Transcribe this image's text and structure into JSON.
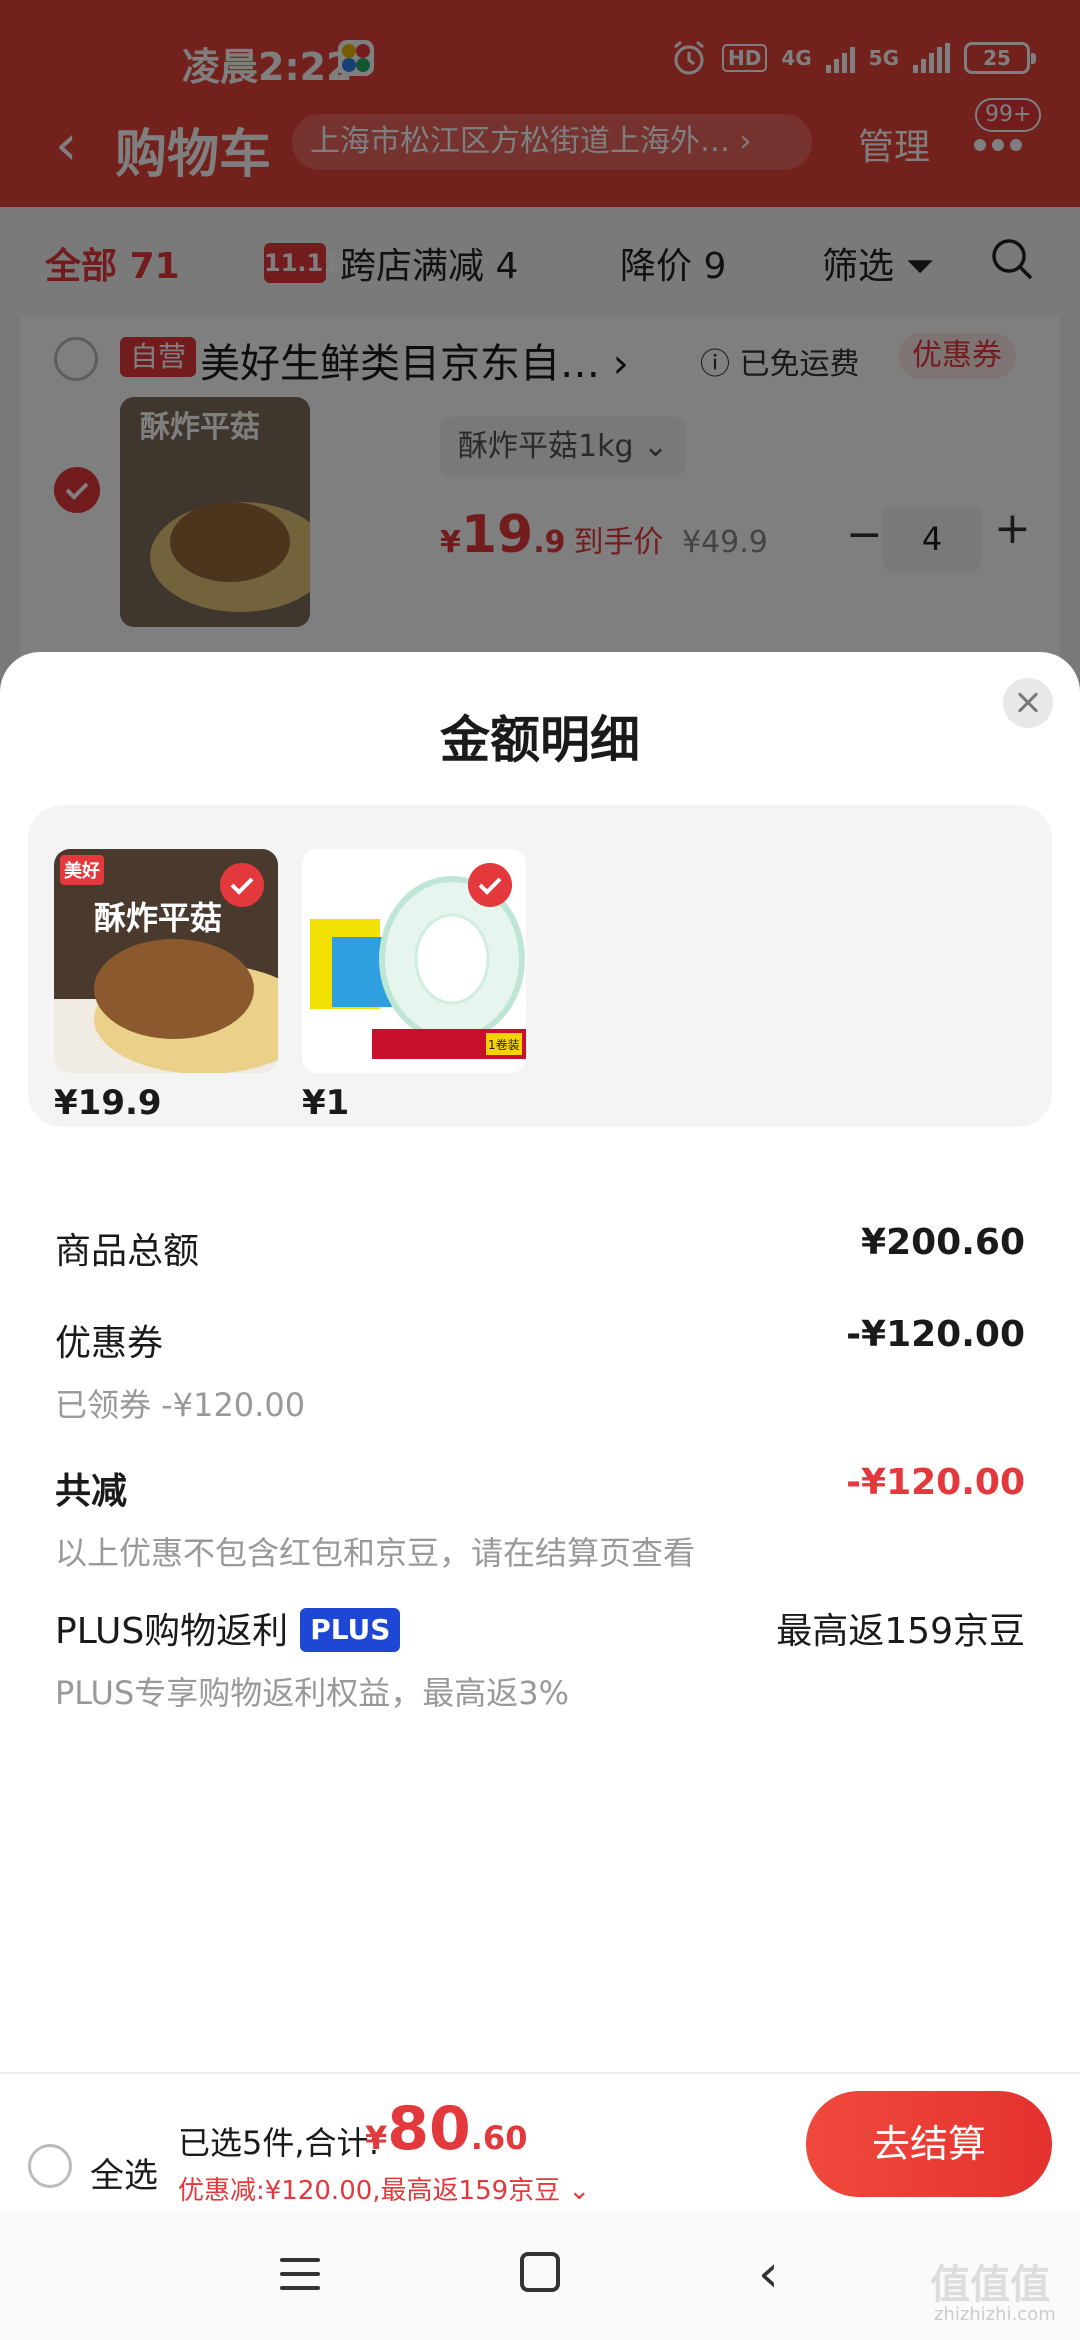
{
  "status_bar": {
    "time": "凌晨2:22",
    "hd": "HD",
    "net1": "4G",
    "net2": "5G",
    "battery": "25"
  },
  "nav": {
    "title": "购物车",
    "address": "上海市松江区方松街道上海外…",
    "manage": "管理",
    "badge": "99+"
  },
  "filters": {
    "all_label": "全部",
    "all_count": "71",
    "cross_icon_text": "11.11",
    "cross_label": "跨店满减",
    "cross_count": "4",
    "drop_label": "降价",
    "drop_count": "9",
    "filter_label": "筛选"
  },
  "shop": {
    "tag": "自营",
    "name": "美好生鲜类目京东自…",
    "arrow": "›",
    "shipping": "已免运费",
    "coupon": "优惠券"
  },
  "cart_item": {
    "spec": "酥炸平菇1kg ⌄",
    "price_yen": "¥",
    "price_int": "19",
    "price_dec": ".9",
    "price_tag": "到手价",
    "original_price": "¥49.9",
    "qty": "4",
    "minus": "−",
    "plus": "+"
  },
  "sheet": {
    "title": "金额明细",
    "products": [
      {
        "price": "¥19.9",
        "name_art": "酥炸平菇",
        "brand_art": "美好"
      },
      {
        "price": "¥1",
        "name_art": "1卷装"
      }
    ],
    "total_label": "商品总额",
    "total_value": "¥200.60",
    "coupon_label": "优惠券",
    "coupon_value": "-¥120.00",
    "coupon_sub": "已领券 -¥120.00",
    "reduce_label": "共减",
    "reduce_value": "-¥120.00",
    "reduce_sub": "以上优惠不包含红包和京豆，请在结算页查看",
    "plus_label": "PLUS购物返利",
    "plus_badge": "PLUS",
    "plus_value": "最高返159京豆",
    "plus_sub": "PLUS专享购物返利权益，最高返3%"
  },
  "bottom": {
    "select_all": "全选",
    "selected": "已选5件,合计:",
    "total_yen": "¥",
    "total_int": "80",
    "total_dec": ".60",
    "savings": "优惠减:¥120.00,最高返159京豆 ⌄",
    "checkout": "去结算"
  },
  "watermark": {
    "text": "值值值",
    "sub": "zhizhizhi.com"
  },
  "colors": {
    "brand_red": "#e4393c",
    "header_red": "#e7433a",
    "plus_blue": "#1f47d6"
  }
}
